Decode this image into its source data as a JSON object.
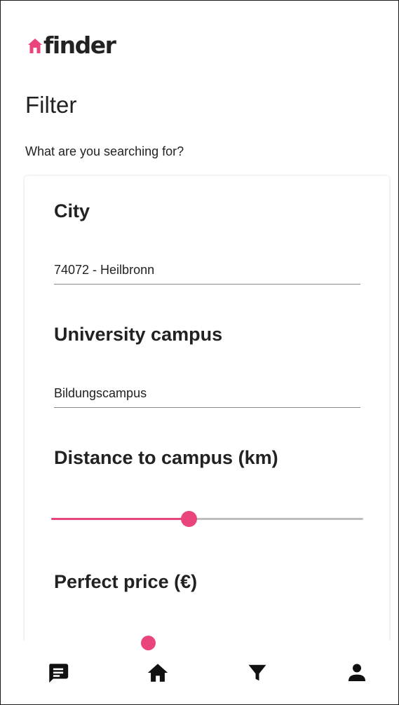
{
  "app": {
    "logo_text": "finder",
    "logo_icon": "house-icon",
    "brand_color": "#e9447c"
  },
  "page": {
    "title": "Filter",
    "subtitle": "What are you searching for?"
  },
  "filters": {
    "city": {
      "label": "City",
      "value": "74072 - Heilbronn"
    },
    "campus": {
      "label": "University campus",
      "value": "Bildungscampus"
    },
    "distance": {
      "label": "Distance to campus (km)",
      "level_fraction": 0.44
    },
    "price": {
      "label": "Perfect price (€)"
    }
  },
  "bottom_nav": {
    "items": [
      {
        "icon": "chat-icon"
      },
      {
        "icon": "home-icon",
        "active": true
      },
      {
        "icon": "filter-icon"
      },
      {
        "icon": "person-icon"
      }
    ]
  }
}
